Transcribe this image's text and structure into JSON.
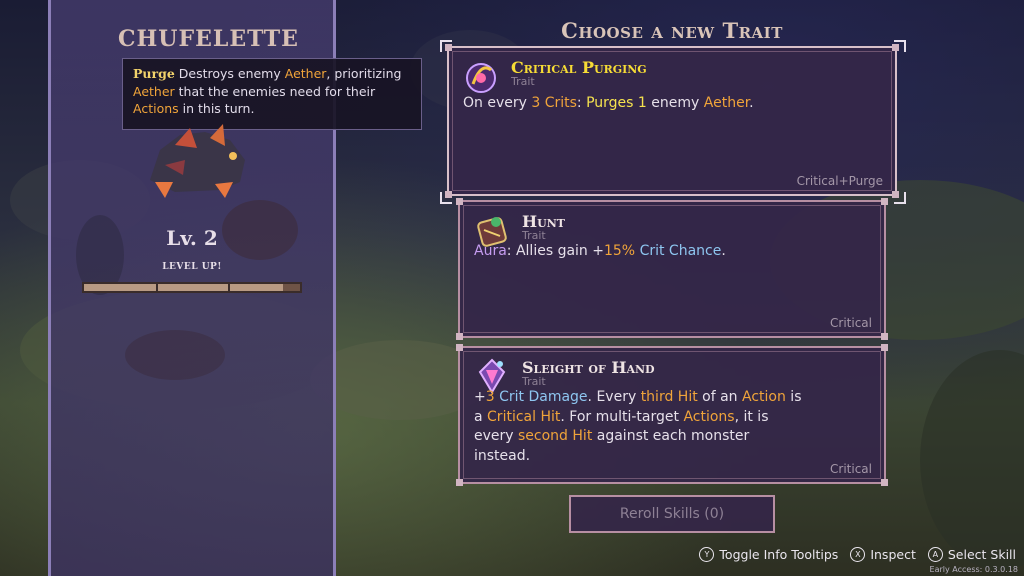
{
  "character": {
    "name": "Chufelette",
    "level": "Lv. 2",
    "level_up": "Level Up!",
    "xp_fraction": 0.92
  },
  "tooltip": {
    "keyword": "Purge",
    "t1": " Destroys enemy ",
    "t2": "Aether",
    "t3": ", prioritizing ",
    "t4": "Aether",
    "t5": " that the enemies need for their ",
    "t6": "Actions",
    "t7": " in this turn."
  },
  "heading": "Choose a new Trait",
  "traits": [
    {
      "title": "Critical Purging",
      "subtitle": "Trait",
      "desc": {
        "a": "On every ",
        "b": "3 Crits",
        "c": ": ",
        "d": "Purges",
        "e": " ",
        "f": "1",
        "g": " enemy ",
        "h": "Aether",
        "i": "."
      },
      "tag": "Critical+Purge",
      "icon": "purge-orb-icon",
      "selected": true
    },
    {
      "title": "Hunt",
      "subtitle": "Trait",
      "desc": {
        "a": "Aura",
        "b": ": Allies gain +",
        "c": "15%",
        "d": " ",
        "e": "Crit Chance",
        "f": "."
      },
      "tag": "Critical",
      "icon": "hunt-bag-icon"
    },
    {
      "title": "Sleight of Hand",
      "subtitle": "Trait",
      "desc": {
        "a": "+",
        "b": "3",
        "c": " ",
        "d": "Crit Damage",
        "e": ". Every ",
        "f": "third Hit",
        "g": " of an ",
        "h": "Action",
        "i": " is",
        "j": "a ",
        "k": "Critical Hit",
        "l": ". For multi-target ",
        "m": "Actions",
        "n": ", it is",
        "o": "every ",
        "p": "second Hit",
        "q": " against each monster",
        "r": "instead."
      },
      "tag": "Critical",
      "icon": "sleight-crystal-icon"
    }
  ],
  "reroll": {
    "label": "Reroll Skills (0)"
  },
  "hints": [
    {
      "glyph": "Y",
      "label": "Toggle Info Tooltips",
      "icon": "y-button-icon"
    },
    {
      "glyph": "X",
      "label": "Inspect",
      "icon": "x-button-icon"
    },
    {
      "glyph": "A",
      "label": "Select Skill",
      "icon": "a-button-icon"
    }
  ],
  "version": "Early Access: 0.3.0.18",
  "colors": {
    "accent_yellow": "#f6e34e",
    "keyword_orange": "#f0a43a",
    "crit_blue": "#8ec6f0",
    "aura_violet": "#c59cf0",
    "panel": "#46396e"
  }
}
